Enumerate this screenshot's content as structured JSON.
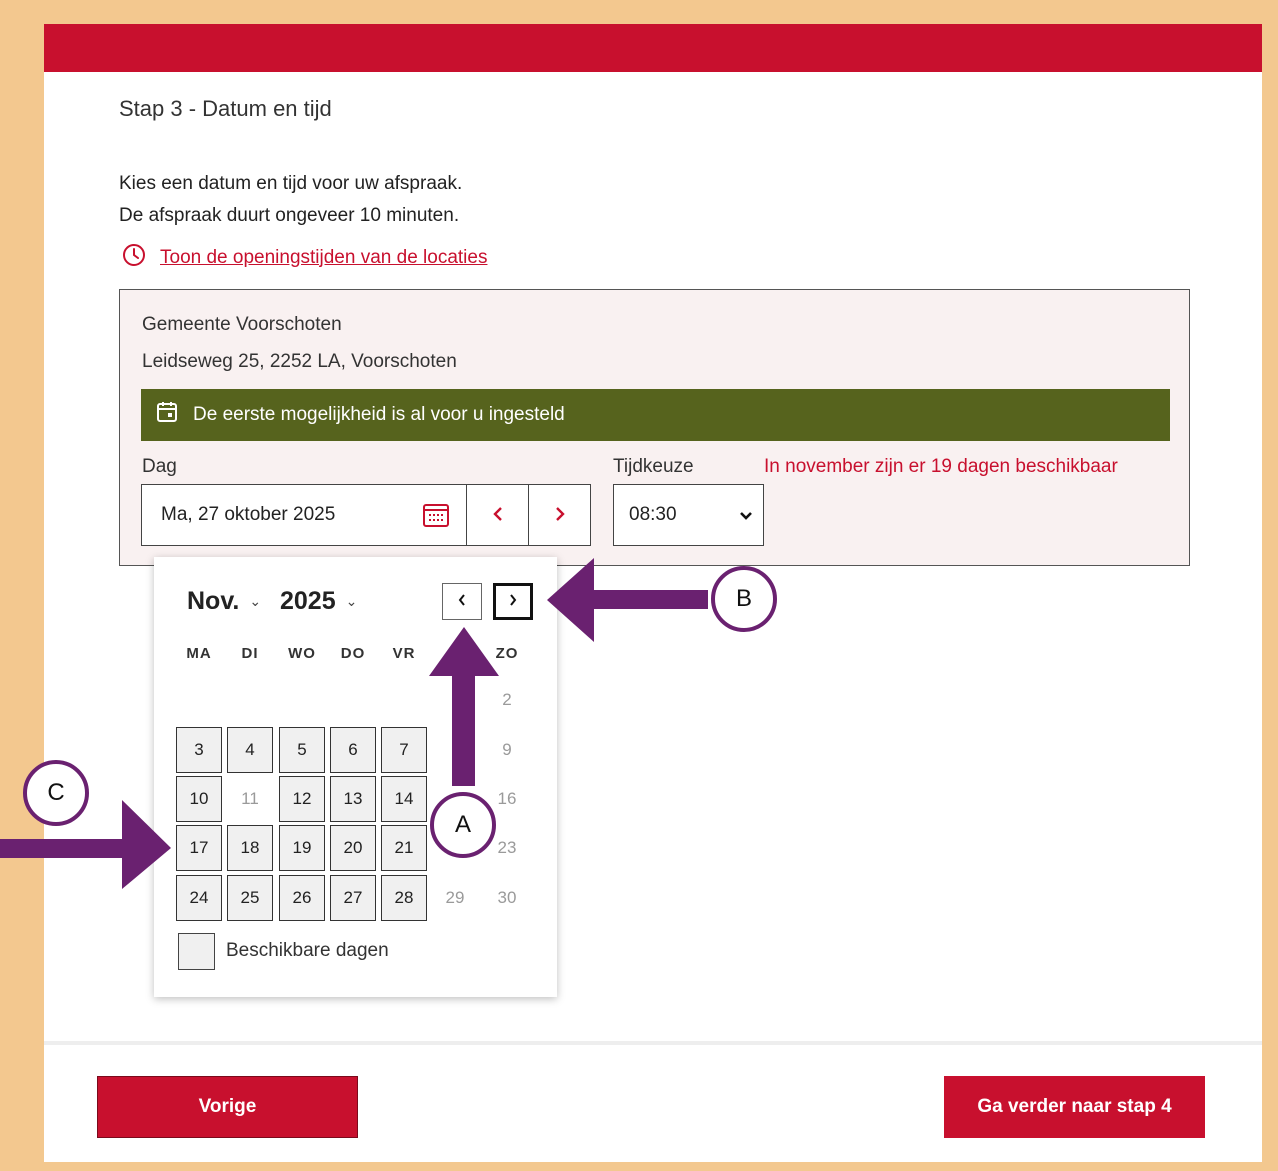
{
  "step_title": "Stap 3 - Datum en tijd",
  "intro": {
    "line1": "Kies een datum en tijd voor uw afspraak.",
    "line2": "De afspraak duurt ongeveer 10 minuten."
  },
  "hours_link": {
    "label": "Toon de openingstijden van de locaties",
    "icon": "clock-icon"
  },
  "location": {
    "name": "Gemeente Voorschoten",
    "address": "Leidseweg 25, 2252 LA, Voorschoten"
  },
  "notice": {
    "text": "De eerste mogelijkheid is al voor u ingesteld",
    "icon": "calendar-icon"
  },
  "day_field": {
    "label": "Dag",
    "value": "Ma, 27 oktober 2025"
  },
  "time_field": {
    "label": "Tijdkeuze",
    "value": "08:30"
  },
  "availability_message": "In november zijn er 19 dagen beschikbaar",
  "calendar": {
    "month": "Nov.",
    "year": "2025",
    "weekdays": [
      "MA",
      "DI",
      "WO",
      "DO",
      "VR",
      "ZO"
    ],
    "legend": "Beschikbare dagen",
    "rows": [
      [
        {
          "d": "2",
          "avail": false,
          "col": 6
        }
      ],
      [
        {
          "d": "3",
          "avail": true,
          "col": 0
        },
        {
          "d": "4",
          "avail": true,
          "col": 1
        },
        {
          "d": "5",
          "avail": true,
          "col": 2
        },
        {
          "d": "6",
          "avail": true,
          "col": 3
        },
        {
          "d": "7",
          "avail": true,
          "col": 4
        },
        {
          "d": "9",
          "avail": false,
          "col": 6
        }
      ],
      [
        {
          "d": "10",
          "avail": true,
          "col": 0
        },
        {
          "d": "11",
          "avail": false,
          "col": 1
        },
        {
          "d": "12",
          "avail": true,
          "col": 2
        },
        {
          "d": "13",
          "avail": true,
          "col": 3
        },
        {
          "d": "14",
          "avail": true,
          "col": 4
        },
        {
          "d": "16",
          "avail": false,
          "col": 6
        }
      ],
      [
        {
          "d": "17",
          "avail": true,
          "col": 0
        },
        {
          "d": "18",
          "avail": true,
          "col": 1
        },
        {
          "d": "19",
          "avail": true,
          "col": 2
        },
        {
          "d": "20",
          "avail": true,
          "col": 3
        },
        {
          "d": "21",
          "avail": true,
          "col": 4
        },
        {
          "d": "23",
          "avail": false,
          "col": 6
        }
      ],
      [
        {
          "d": "24",
          "avail": true,
          "col": 0
        },
        {
          "d": "25",
          "avail": true,
          "col": 1
        },
        {
          "d": "26",
          "avail": true,
          "col": 2
        },
        {
          "d": "27",
          "avail": true,
          "col": 3
        },
        {
          "d": "28",
          "avail": true,
          "col": 4
        },
        {
          "d": "29",
          "avail": false,
          "col": 5
        },
        {
          "d": "30",
          "avail": false,
          "col": 6
        }
      ]
    ]
  },
  "buttons": {
    "previous": "Vorige",
    "next": "Ga verder naar stap 4"
  },
  "annotations": {
    "a": "A",
    "b": "B",
    "c": "C"
  },
  "colors": {
    "brand_red": "#c8102e",
    "notice_green": "#56631d",
    "annotation_purple": "#6a2170",
    "frame": "#f3c88f"
  }
}
